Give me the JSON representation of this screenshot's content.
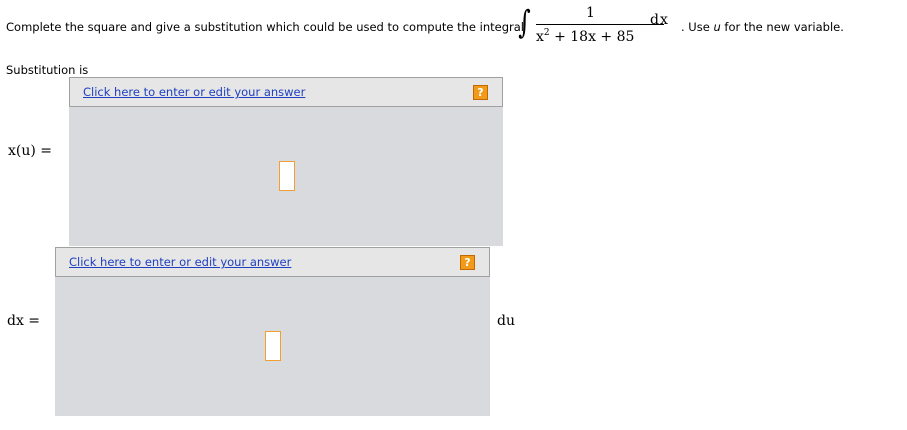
{
  "prompt": {
    "text": "Complete the square and give a substitution which could be used to compute the integral",
    "integrand_numerator": "1",
    "integrand_denominator_parts": [
      "x",
      "2",
      " + 18x + 85"
    ],
    "differential": "dx",
    "note_prefix": ". Use ",
    "note_variable": "u",
    "note_suffix": " for the new variable."
  },
  "substitution_label": "Substitution is",
  "answers": [
    {
      "link_text": "Click here to enter or edit your answer",
      "help_label": "?",
      "lhs_label": "x(u) =",
      "rhs_label": ""
    },
    {
      "link_text": "Click here to enter or edit your answer",
      "help_label": "?",
      "lhs_label": "dx =",
      "rhs_label": "du"
    }
  ],
  "colors": {
    "link": "#1f3fbf",
    "help_button": "#f29a1a",
    "placeholder_border": "#f0a030",
    "panel_background": "#d8dadd",
    "bar_background": "#e6e6e6"
  }
}
